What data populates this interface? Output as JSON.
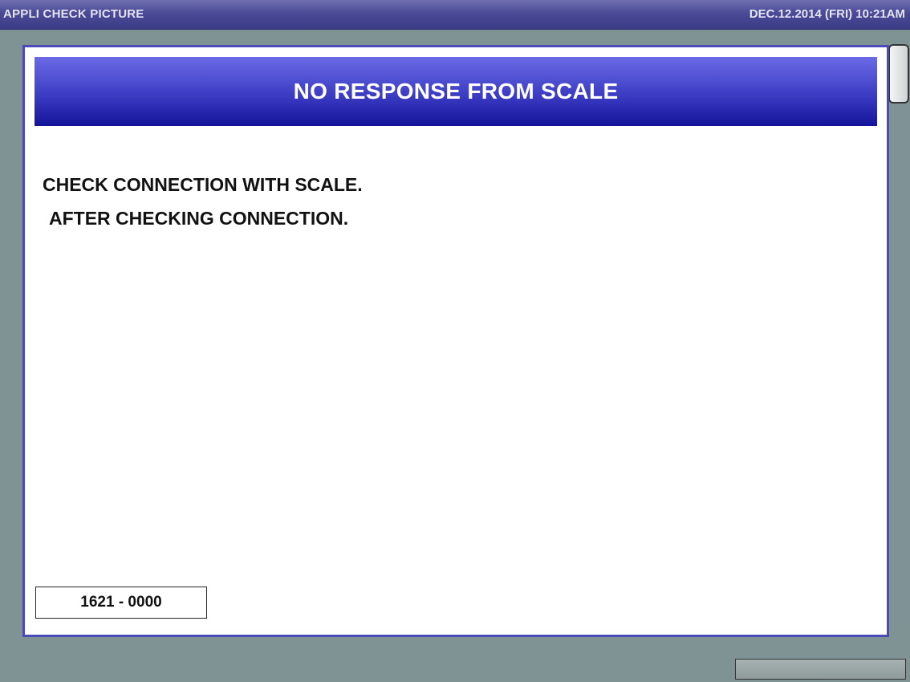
{
  "topbar": {
    "title": "APPLI CHECK PICTURE",
    "datetime": "DEC.12.2014 (FRI)  10:21AM"
  },
  "dialog": {
    "header": "NO RESPONSE FROM SCALE",
    "message_line1": "CHECK CONNECTION WITH SCALE.",
    "message_line2": "AFTER CHECKING CONNECTION.",
    "code": "1621 - 0000"
  },
  "colors": {
    "topbar": "#3b3b86",
    "header": "#3c3cc4",
    "background": "#7f9294"
  }
}
